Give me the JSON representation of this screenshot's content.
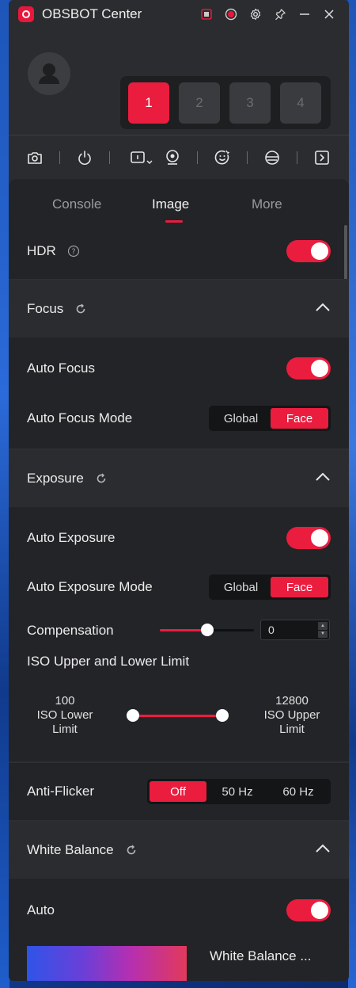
{
  "titlebar": {
    "title": "OBSBOT Center",
    "icons": [
      "window-icon",
      "record-icon",
      "settings-icon",
      "pin-icon",
      "minimize-icon",
      "close-icon"
    ]
  },
  "devices": {
    "slots": [
      "1",
      "2",
      "3",
      "4"
    ],
    "active_slot": "1"
  },
  "toolbar": {
    "icons": [
      "camera-snapshot-icon",
      "power-icon",
      "video-mode-icon",
      "webcam-icon",
      "ai-tracking-icon",
      "gimbal-icon",
      "expand-panel-icon"
    ]
  },
  "tabs": [
    {
      "label": "Console"
    },
    {
      "label": "Image"
    },
    {
      "label": "More"
    }
  ],
  "active_tab": "Image",
  "hdr": {
    "label": "HDR",
    "enabled": true
  },
  "focus": {
    "title": "Focus",
    "auto_focus_label": "Auto Focus",
    "auto_focus_enabled": true,
    "mode_label": "Auto Focus Mode",
    "mode_options": [
      "Global",
      "Face"
    ],
    "mode_selected": "Face"
  },
  "exposure": {
    "title": "Exposure",
    "auto_exposure_label": "Auto Exposure",
    "auto_exposure_enabled": true,
    "mode_label": "Auto Exposure Mode",
    "mode_options": [
      "Global",
      "Face"
    ],
    "mode_selected": "Face",
    "compensation_label": "Compensation",
    "compensation_value": "0",
    "iso_label": "ISO Upper and Lower Limit",
    "iso_lower_value": "100",
    "iso_lower_line1": "ISO Lower",
    "iso_lower_line2": "Limit",
    "iso_upper_value": "12800",
    "iso_upper_line1": "ISO Upper",
    "iso_upper_line2": "Limit"
  },
  "anti_flicker": {
    "label": "Anti-Flicker",
    "options": [
      "Off",
      "50 Hz",
      "60 Hz"
    ],
    "selected": "Off"
  },
  "white_balance": {
    "title": "White Balance",
    "auto_label": "Auto",
    "auto_enabled": true,
    "preset_label": "White Balance ..."
  },
  "colors": {
    "accent": "#ea1d3f",
    "panel_bg": "#232427",
    "window_bg": "#2b2c2f"
  }
}
